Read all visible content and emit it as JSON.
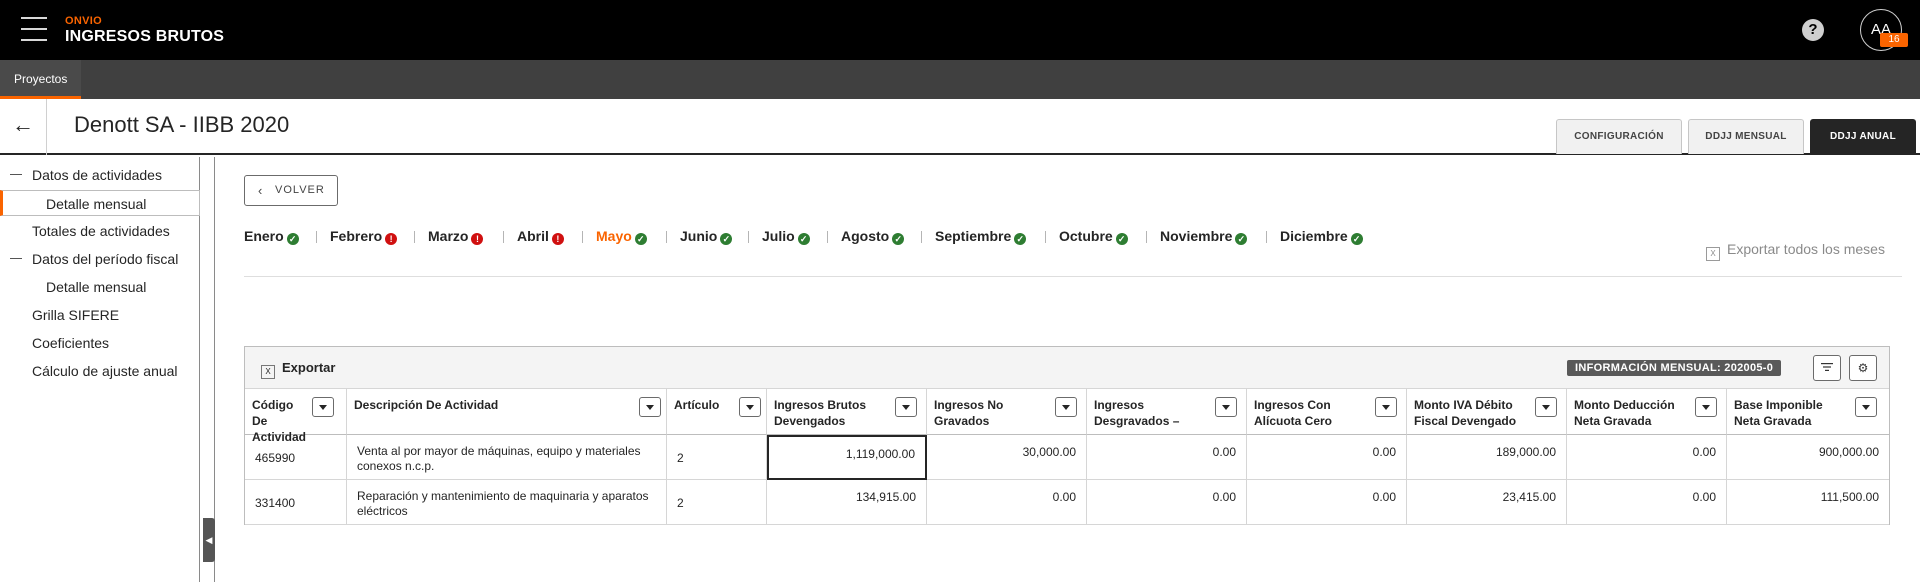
{
  "app": {
    "brand": "ONVIO",
    "name": "INGRESOS BRUTOS",
    "help_symbol": "?",
    "user_initials": "AA",
    "user_badge": "16"
  },
  "nav": {
    "tab_label": "Proyectos"
  },
  "header": {
    "title": "Denott SA - IIBB 2020",
    "back_symbol": "←",
    "tabs": [
      {
        "label": "CONFIGURACIÓN",
        "active": false
      },
      {
        "label": "DDJJ MENSUAL",
        "active": false
      },
      {
        "label": "DDJJ ANUAL",
        "active": true
      }
    ]
  },
  "sidebar": {
    "items": [
      {
        "label": "Datos de actividades",
        "level": 0,
        "dash": true,
        "active": false
      },
      {
        "label": "Detalle mensual",
        "level": 1,
        "dash": false,
        "active": true
      },
      {
        "label": "Totales de actividades",
        "level": 0,
        "dash": false,
        "active": false
      },
      {
        "label": "Datos del período fiscal",
        "level": 0,
        "dash": true,
        "active": false
      },
      {
        "label": "Detalle mensual",
        "level": 1,
        "dash": false,
        "active": false
      },
      {
        "label": "Grilla SIFERE",
        "level": 0,
        "dash": false,
        "active": false
      },
      {
        "label": "Coeficientes",
        "level": 0,
        "dash": false,
        "active": false
      },
      {
        "label": "Cálculo de ajuste anual",
        "level": 0,
        "dash": false,
        "active": false
      }
    ]
  },
  "main": {
    "volver_label": "VOLVER",
    "volver_chevron": "‹",
    "export_all_label": "Exportar todos los meses",
    "months": [
      {
        "label": "Enero",
        "status": "ok",
        "current": false
      },
      {
        "label": "Febrero",
        "status": "err",
        "current": false
      },
      {
        "label": "Marzo",
        "status": "err",
        "current": false
      },
      {
        "label": "Abril",
        "status": "err",
        "current": false
      },
      {
        "label": "Mayo",
        "status": "ok",
        "current": true
      },
      {
        "label": "Junio",
        "status": "ok",
        "current": false
      },
      {
        "label": "Julio",
        "status": "ok",
        "current": false
      },
      {
        "label": "Agosto",
        "status": "ok",
        "current": false
      },
      {
        "label": "Septiembre",
        "status": "ok",
        "current": false
      },
      {
        "label": "Octubre",
        "status": "ok",
        "current": false
      },
      {
        "label": "Noviembre",
        "status": "ok",
        "current": false
      },
      {
        "label": "Diciembre",
        "status": "ok",
        "current": false
      }
    ],
    "status_symbols": {
      "ok": "✓",
      "err": "!"
    },
    "colors": {
      "accent": "#fa6400",
      "ok": "#2e7d32",
      "err": "#d01010"
    }
  },
  "grid": {
    "export_label": "Exportar",
    "excel_symbol": "X",
    "info_badge": "INFORMACIÓN MENSUAL: 202005-0",
    "columns": [
      "Código De Actividad",
      "Descripción De Actividad",
      "Artículo",
      "Ingresos Brutos Devengados",
      "Ingresos No Gravados",
      "Ingresos Desgravados –",
      "Ingresos Con Alícuota Cero",
      "Monto IVA Débito Fiscal Devengado",
      "Monto Deducción Neta Gravada",
      "Base Imponible Neta Gravada"
    ],
    "rows": [
      [
        "465990",
        "Venta al por mayor de máquinas, equipo y materiales conexos n.c.p.",
        "2",
        "1,119,000.00",
        "30,000.00",
        "0.00",
        "0.00",
        "189,000.00",
        "0.00",
        "900,000.00"
      ],
      [
        "331400",
        "Reparación y mantenimiento de maquinaria y aparatos eléctricos",
        "2",
        "134,915.00",
        "0.00",
        "0.00",
        "0.00",
        "23,415.00",
        "0.00",
        "111,500.00"
      ]
    ]
  }
}
